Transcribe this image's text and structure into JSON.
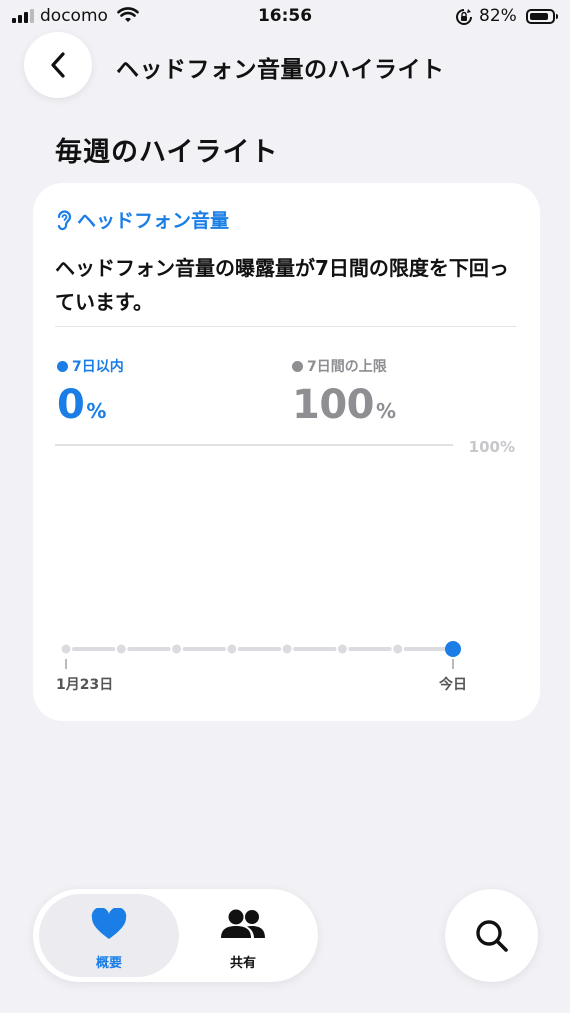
{
  "status_bar": {
    "carrier": "docomo",
    "time": "16:56",
    "battery_percent": "82%",
    "battery_level": 0.82
  },
  "nav": {
    "title": "ヘッドフォン音量のハイライト",
    "back_icon": "chevron-left-icon"
  },
  "section": {
    "title": "毎週のハイライト"
  },
  "card": {
    "header_label": "ヘッドフォン音量",
    "header_icon": "ear-icon",
    "description": "ヘッドフォン音量の曝露量が7日間の限度を下回っています。",
    "stats": [
      {
        "label": "7日以内",
        "value": "0",
        "unit": "%",
        "color": "#1a7ee6"
      },
      {
        "label": "7日間の上限",
        "value": "100",
        "unit": "%",
        "color": "#8e8e93"
      }
    ]
  },
  "chart_data": {
    "type": "line",
    "ylabel_right": "100%",
    "ylim": [
      0,
      100
    ],
    "x_labels": [
      "1月23日",
      "今日"
    ],
    "limit_line": 100,
    "series": [
      {
        "values": [
          0,
          0,
          0,
          0,
          0,
          0,
          0,
          0
        ]
      }
    ],
    "point_count": 8,
    "highlight_index": 7,
    "series_color": "#1a7ee6",
    "limit_color": "#e0e0e5"
  },
  "tabbar": {
    "tabs": [
      {
        "label": "概要",
        "icon": "heart-icon",
        "selected": true
      },
      {
        "label": "共有",
        "icon": "people-icon",
        "selected": false
      }
    ],
    "search_icon": "search-icon"
  }
}
